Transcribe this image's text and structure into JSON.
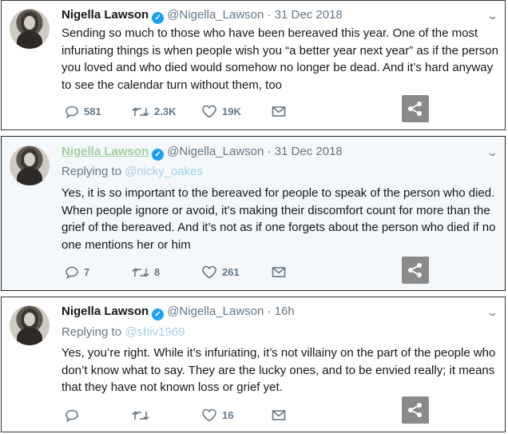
{
  "author": {
    "name": "Nigella Lawson",
    "handle": "@Nigella_Lawson",
    "verified_glyph": "✓"
  },
  "tweets": [
    {
      "timestamp": "31 Dec 2018",
      "separator": "·",
      "replying_label": "",
      "replying_to": "",
      "text": "Sending so much to those who have been bereaved this year. One of the most infuriating things is when people wish you “a better year next year” as if the person you loved and who died would somehow no longer be dead. And it’s hard anyway to see the calendar turn without them, too",
      "replies": "581",
      "retweets": "2.3K",
      "likes": "19K"
    },
    {
      "timestamp": "31 Dec 2018",
      "separator": "·",
      "replying_label": "Replying to",
      "replying_to": "@nicky_oakes",
      "text": "Yes, it is so important to the bereaved for people to speak of the person who died. When people ignore or avoid, it’s making their discomfort count for more than the grief of the bereaved. And it’s not as if one forgets about the person who died if no one mentions her or him",
      "replies": "7",
      "retweets": "8",
      "likes": "261"
    },
    {
      "timestamp": "16h",
      "separator": "·",
      "replying_label": "Replying to",
      "replying_to": "@shiv1969",
      "text": "Yes, you’re right. While it’s infuriating, it’s not villainy on the part of the people who don’t know what to say. They are the lucky ones, and to be envied really; it means that they have not known loss or grief yet.",
      "replies": "",
      "retweets": "",
      "likes": "16"
    }
  ],
  "icons": {
    "reply": "reply-icon",
    "retweet": "retweet-icon",
    "like": "heart-icon",
    "dm": "envelope-icon",
    "share": "share-icon",
    "more": "chevron-down-icon"
  },
  "colors": {
    "verified": "#1da1f2",
    "muted": "#657786",
    "share_bg": "#8a8a8a",
    "highlight_bg": "#f5f8fa"
  }
}
